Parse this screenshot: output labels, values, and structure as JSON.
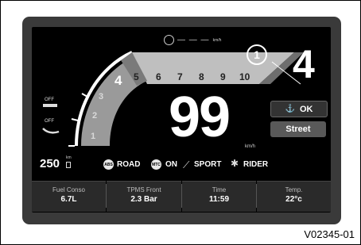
{
  "top_speed": {
    "dashes": "— — —",
    "unit": "km/h"
  },
  "rpm_scale": [
    "4",
    "5",
    "6",
    "7",
    "8",
    "9",
    "10"
  ],
  "gauge_labels": [
    "1",
    "2",
    "3"
  ],
  "gear": "4",
  "callout": "1",
  "speed": {
    "value": "99",
    "unit": "km/h"
  },
  "ok_button": {
    "label": "OK"
  },
  "mode_button": {
    "label": "Street"
  },
  "left_indicators": {
    "top": "OFF",
    "bottom": "OFF"
  },
  "fuel_range": {
    "value": "250",
    "unit": "km"
  },
  "status_bar": {
    "abs_badge": "ABS",
    "abs_mode": "ROAD",
    "mtc_badge": "MTC",
    "mtc_state": "ON",
    "riding_mode": "SPORT",
    "rider": "RIDER"
  },
  "bottom_panels": [
    {
      "label": "Fuel Conso",
      "value": "6.7L"
    },
    {
      "label": "TPMS Front",
      "value": "2.3 Bar"
    },
    {
      "label": "Time",
      "value": "11:59"
    },
    {
      "label": "Temp.",
      "value": "22°c"
    }
  ],
  "figure_id": "V02345-01",
  "colors": {
    "screen": "#000000",
    "bezel": "#3a3a3a",
    "band": "#bfbfbf"
  }
}
